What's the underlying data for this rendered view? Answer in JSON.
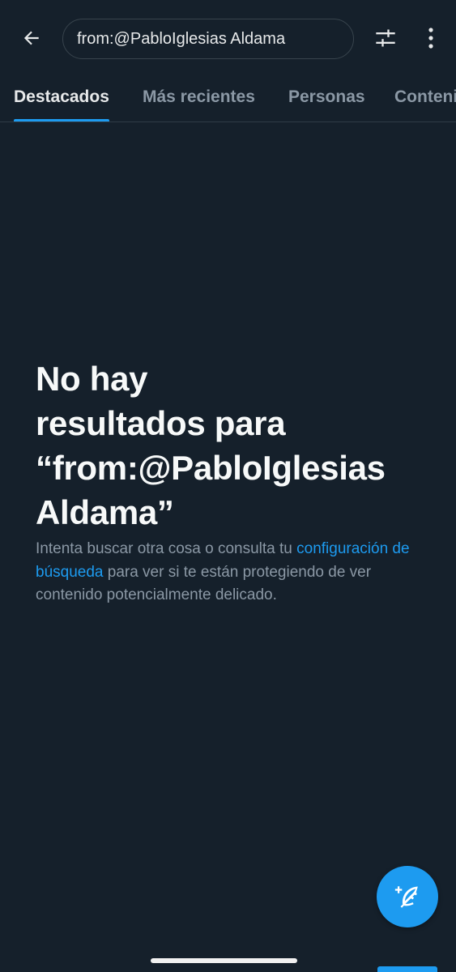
{
  "header": {
    "back_icon": "arrow-left-icon",
    "search": {
      "value": "from:@PabloIglesias Aldama"
    },
    "filter_icon": "sliders-icon",
    "more_icon": "kebab-menu-icon"
  },
  "tabs": [
    {
      "label": "Destacados",
      "active": true
    },
    {
      "label": "Más recientes",
      "active": false
    },
    {
      "label": "Personas",
      "active": false
    },
    {
      "label": "Contenido multimedia",
      "active": false
    }
  ],
  "empty_state": {
    "title": "No hay\nresultados para\n“from:@PabloIglesias\nAldama”",
    "desc_before": "Intenta buscar otra cosa o consulta tu ",
    "desc_link": "configuración de búsqueda",
    "desc_after": " para ver si te están protegiendo de ver contenido potencialmente delicado."
  },
  "fab": {
    "icon": "compose-feather-plus-icon"
  },
  "colors": {
    "background": "#15202b",
    "accent": "#1d9bf0",
    "text_primary": "#e7e9ea",
    "text_secondary": "#8b98a5",
    "border": "#38444d"
  }
}
